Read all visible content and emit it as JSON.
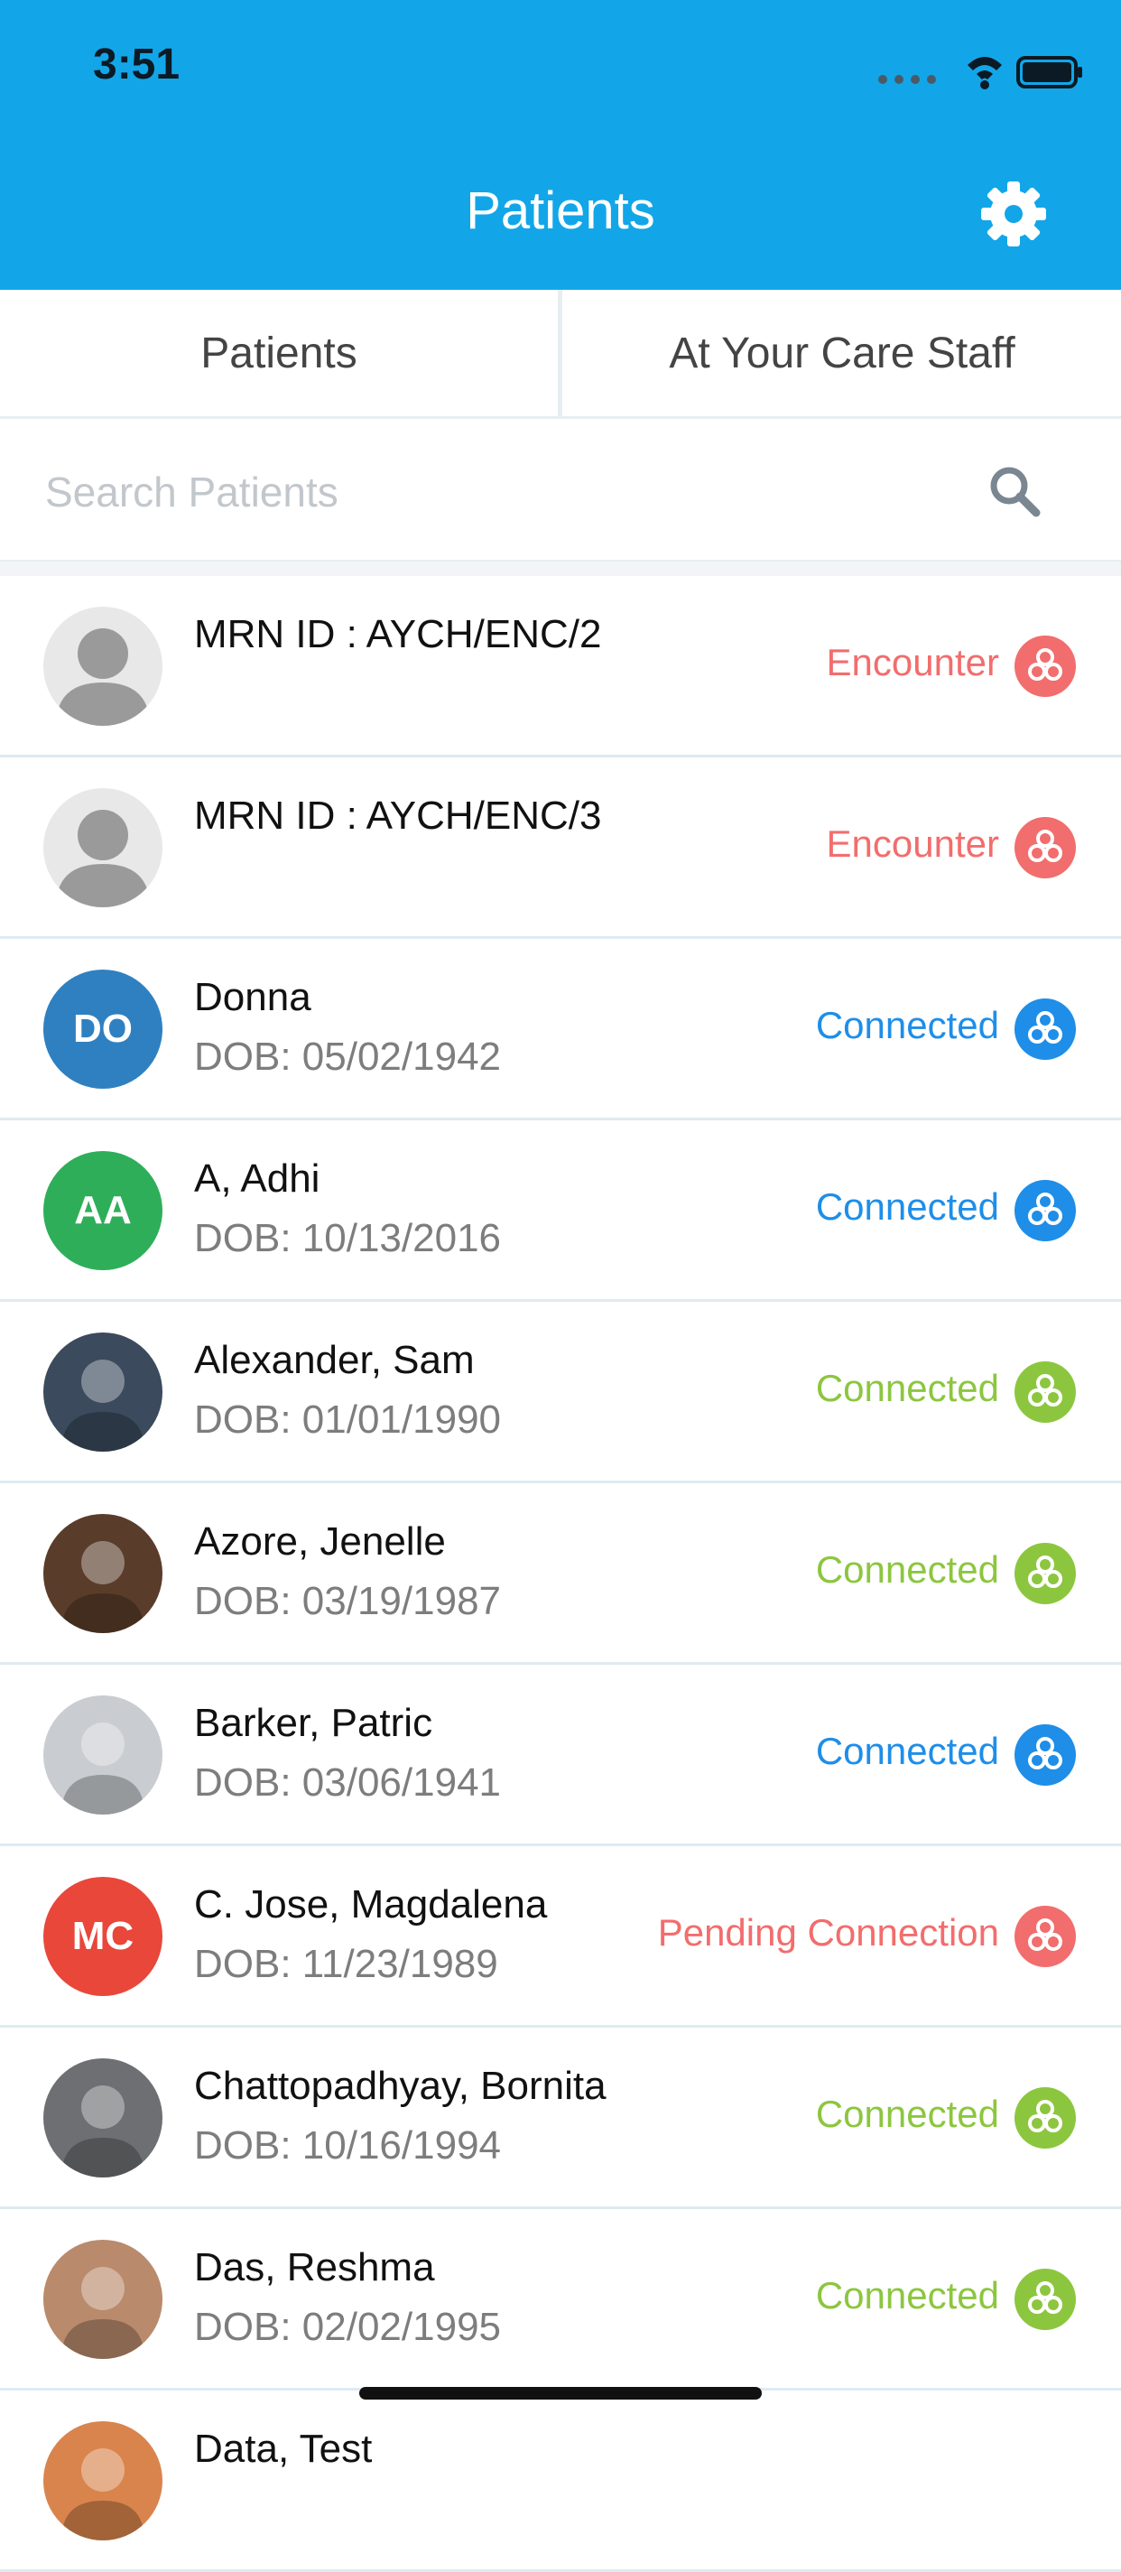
{
  "status_bar": {
    "time": "3:51"
  },
  "header": {
    "title": "Patients"
  },
  "tabs": {
    "left": "Patients",
    "right": "At Your Care Staff"
  },
  "search": {
    "placeholder": "Search Patients"
  },
  "colors": {
    "header": "#12a6e8",
    "encounter": "#f26d6d",
    "connected_blue": "#1e8ee8",
    "connected_green": "#8cc63f",
    "pending": "#f26d6d"
  },
  "patients": [
    {
      "name": "MRN ID : AYCH/ENC/2",
      "dob": "",
      "status": "Encounter",
      "status_color": "#f26d6d",
      "avatar": "placeholder"
    },
    {
      "name": "MRN ID : AYCH/ENC/3",
      "dob": "",
      "status": "Encounter",
      "status_color": "#f26d6d",
      "avatar": "placeholder"
    },
    {
      "name": "Donna",
      "dob": "DOB: 05/02/1942",
      "status": "Connected",
      "status_color": "#1e8ee8",
      "avatar": "initials",
      "initials": "DO",
      "avatar_color": "#2f80c0"
    },
    {
      "name": "A, Adhi",
      "dob": "DOB: 10/13/2016",
      "status": "Connected",
      "status_color": "#1e8ee8",
      "avatar": "initials",
      "initials": "AA",
      "avatar_color": "#2fae5a"
    },
    {
      "name": "Alexander, Sam",
      "dob": "DOB: 01/01/1990",
      "status": "Connected",
      "status_color": "#8cc63f",
      "avatar": "photo",
      "avatar_color": "#3b4a5c"
    },
    {
      "name": "Azore, Jenelle",
      "dob": "DOB: 03/19/1987",
      "status": "Connected",
      "status_color": "#8cc63f",
      "avatar": "photo",
      "avatar_color": "#5a3c2a"
    },
    {
      "name": "Barker, Patric",
      "dob": "DOB: 03/06/1941",
      "status": "Connected",
      "status_color": "#1e8ee8",
      "avatar": "photo",
      "avatar_color": "#c9cdd1"
    },
    {
      "name": "C. Jose, Magdalena",
      "dob": "DOB: 11/23/1989",
      "status": "Pending Connection",
      "status_color": "#f26d6d",
      "avatar": "initials",
      "initials": "MC",
      "avatar_color": "#e8473a"
    },
    {
      "name": "Chattopadhyay, Bornita",
      "dob": "DOB: 10/16/1994",
      "status": "Connected",
      "status_color": "#8cc63f",
      "avatar": "photo",
      "avatar_color": "#6d6f72"
    },
    {
      "name": "Das, Reshma",
      "dob": "DOB: 02/02/1995",
      "status": "Connected",
      "status_color": "#8cc63f",
      "avatar": "photo",
      "avatar_color": "#b98a6c"
    },
    {
      "name": "Data, Test",
      "dob": "",
      "status": "",
      "status_color": "#8cc63f",
      "avatar": "photo",
      "avatar_color": "#d9844d"
    }
  ]
}
